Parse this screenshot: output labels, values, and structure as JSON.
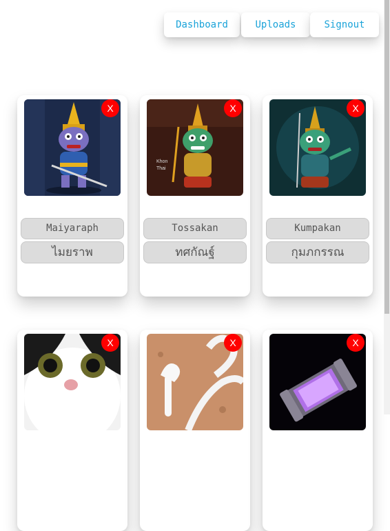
{
  "nav": {
    "dashboard": "Dashboard",
    "uploads": "Uploads",
    "signout": "Signout"
  },
  "delete_label": "X",
  "cards": [
    {
      "name_en": "Maiyaraph",
      "name_th": "ไมยราพ",
      "image": "purple-faced demon warrior figure"
    },
    {
      "name_en": "Tossakan",
      "name_th": "ทศกัณฐ์",
      "image": "green-faced demon king figure"
    },
    {
      "name_en": "Kumpakan",
      "name_th": "กุมภกรรณ",
      "image": "green-faced demon warrior with spear"
    },
    {
      "name_en": "",
      "name_th": "",
      "image": "black and white cat"
    },
    {
      "name_en": "",
      "name_th": "",
      "image": "white cobra snake"
    },
    {
      "name_en": "",
      "name_th": "",
      "image": "purple glowing metal cylinder"
    }
  ],
  "colors": {
    "nav_text": "#1aa3d9",
    "delete_bg": "#ff0000",
    "label_bg": "#dcdcdc"
  }
}
